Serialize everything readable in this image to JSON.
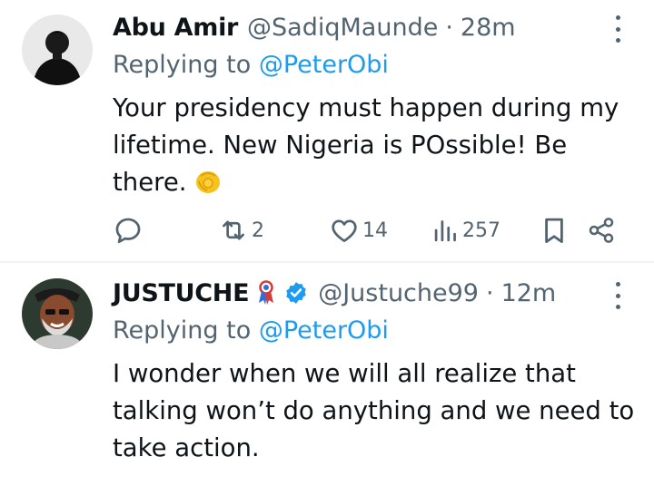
{
  "tweets": [
    {
      "name": "Abu Amir",
      "handle": "@SadiqMaunde",
      "dot": "·",
      "time": "28m",
      "replying_prefix": "Replying to ",
      "replying_to": "@PeterObi",
      "text": "Your presidency must happen during my lifetime. New Nigeria is POssible! Be there.",
      "emoji": "point-at-viewer-emoji",
      "stats": {
        "retweets": "2",
        "likes": "14",
        "views": "257"
      }
    },
    {
      "name": "JUSTUCHE",
      "handle": "@Justuche99",
      "dot": "·",
      "time": "12m",
      "replying_prefix": "Replying to ",
      "replying_to": "@PeterObi",
      "text": "I wonder when we will all realize that talking won’t do anything and we need to take action.",
      "badges": [
        "ribbon-badge-icon",
        "verified-badge-icon"
      ]
    }
  ],
  "colors": {
    "text": "#0f1419",
    "secondary": "#536471",
    "link": "#1d9bf0",
    "divider": "#eff3f4",
    "verified": "#1d9bf0"
  }
}
